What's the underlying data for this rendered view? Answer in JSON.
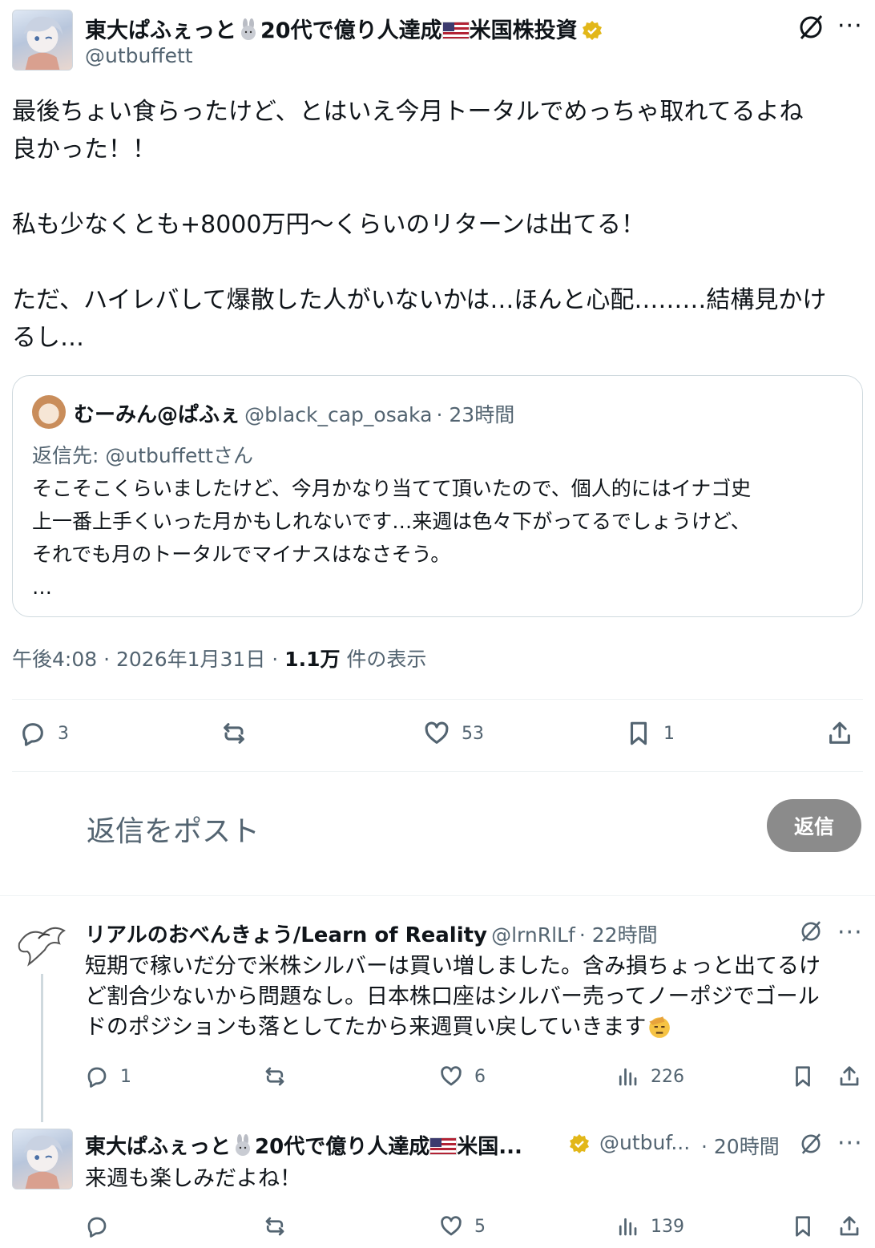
{
  "post": {
    "name": "東大ぱふぇっと",
    "name_suffix_num": "20代で億り人達成",
    "name_suffix_end": "米国株投資",
    "handle": "@utbuffett",
    "text": "最後ちょい食らったけど、とはいえ今月トータルでめっちゃ取れてるよね\n良かった！！\n\n私も少なくとも+8000万円〜くらいのリターンは出てる！\n\nただ、ハイレバして爆散した人がいないかは…ほんと心配………結構見かけ\nるし…",
    "quote": {
      "name": "むーみん@ぱふぇ",
      "handle": "@black_cap_osaka",
      "time": "· 23時間",
      "reply_to": "返信先: @utbuffettさん",
      "text": "そこそこくらいましたけど、今月かなり当てて頂いたので、個人的にはイナゴ史\n上一番上手くいった月かもしれないです…来週は色々下がってるでしょうけど、\nそれでも月のトータルでマイナスはなさそう。\n…"
    },
    "meta_time": "午後4:08 · 2026年1月31日 · ",
    "views_count": "1.1万",
    "views_label": "件の表示",
    "actions": {
      "replies": "3",
      "retweets": "",
      "likes": "53",
      "bookmarks": "1"
    }
  },
  "compose": {
    "placeholder": "返信をポスト",
    "button": "返信"
  },
  "replies": [
    {
      "name": "リアルのおべんきょう/Learn of Reality",
      "handle": "@lrnRlLf",
      "time": "· 22時間",
      "text": "短期で稼いだ分で米株シルバーは買い増しました。含み損ちょっと出てるけ\nど割合少ないから問題なし。日本株口座はシルバー売ってノーポジでゴール\nドのポジションも落としてたから来週買い戻していきます",
      "replies": "1",
      "retweets": "",
      "likes": "6",
      "views": "226"
    },
    {
      "name": "東大ぱふぇっと",
      "name_mid": "20代で億り人達成",
      "name_end": "米国...",
      "handle": "@utbuf...",
      "time": "· 20時間",
      "text": "来週も楽しみだよね！",
      "replies": "",
      "retweets": "",
      "likes": "5",
      "views": "139"
    }
  ],
  "colors": {
    "text": "#0f1419",
    "secondary": "#536471",
    "verified": "#e2b719",
    "reply_button": "#8b8b8b"
  }
}
